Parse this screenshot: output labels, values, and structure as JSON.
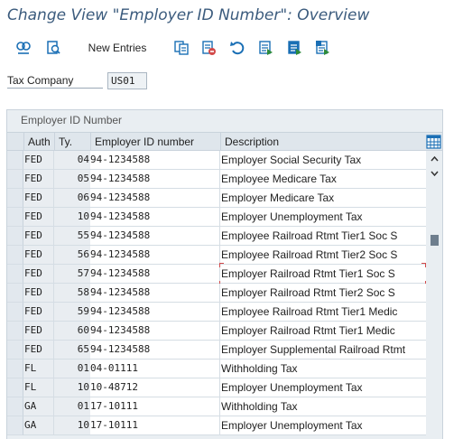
{
  "title": "Change View \"Employer ID Number\": Overview",
  "toolbar": {
    "new_entries_label": "New Entries",
    "icons": [
      "display-change-icon",
      "details-icon",
      "copy-as-icon",
      "delete-icon",
      "undo-icon",
      "select-all-icon",
      "select-block-icon",
      "deselect-all-icon"
    ]
  },
  "tax_company": {
    "label": "Tax Company",
    "value": "US01"
  },
  "panel": {
    "title": "Employer ID Number",
    "columns": [
      "Auth",
      "Ty.",
      "Employer ID number",
      "Description"
    ],
    "rows": [
      {
        "auth": "FED",
        "ty": "04",
        "id": "94-1234588",
        "desc": "Employer Social Security Tax"
      },
      {
        "auth": "FED",
        "ty": "05",
        "id": "94-1234588",
        "desc": "Employee Medicare Tax"
      },
      {
        "auth": "FED",
        "ty": "06",
        "id": "94-1234588",
        "desc": "Employer Medicare Tax"
      },
      {
        "auth": "FED",
        "ty": "10",
        "id": "94-1234588",
        "desc": "Employer Unemployment Tax"
      },
      {
        "auth": "FED",
        "ty": "55",
        "id": "94-1234588",
        "desc": "Employee Railroad Rtmt Tier1 Soc S"
      },
      {
        "auth": "FED",
        "ty": "56",
        "id": "94-1234588",
        "desc": "Employee Railroad Rtmt Tier2 Soc S"
      },
      {
        "auth": "FED",
        "ty": "57",
        "id": "94-1234588",
        "desc": "Employer Railroad Rtmt Tier1 Soc S"
      },
      {
        "auth": "FED",
        "ty": "58",
        "id": "94-1234588",
        "desc": "Employer Railroad Rtmt Tier2 Soc S"
      },
      {
        "auth": "FED",
        "ty": "59",
        "id": "94-1234588",
        "desc": "Employee Railroad Rtmt Tier1 Medic"
      },
      {
        "auth": "FED",
        "ty": "60",
        "id": "94-1234588",
        "desc": "Employer Railroad Rtmt Tier1 Medic"
      },
      {
        "auth": "FED",
        "ty": "65",
        "id": "94-1234588",
        "desc": "Employer Supplemental Railroad Rtmt"
      },
      {
        "auth": "FL",
        "ty": "01",
        "id": "04-01111",
        "desc": "Withholding Tax"
      },
      {
        "auth": "FL",
        "ty": "10",
        "id": "10-48712",
        "desc": "Employer Unemployment Tax"
      },
      {
        "auth": "GA",
        "ty": "01",
        "id": "17-10111",
        "desc": "Withholding Tax"
      },
      {
        "auth": "GA",
        "ty": "10",
        "id": "17-10111",
        "desc": "Employer Unemployment Tax"
      }
    ]
  },
  "colors": {
    "title": "#3b5b7d",
    "accent": "#1a6fb5",
    "focus": "#d24a4a"
  }
}
